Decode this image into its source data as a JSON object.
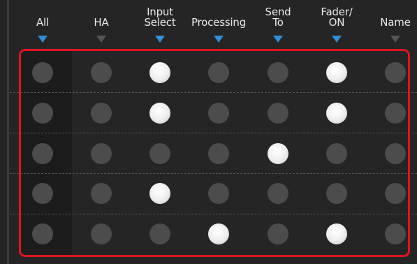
{
  "columns": [
    {
      "key": "all",
      "label": "All",
      "arrow_color": "#2f90d7"
    },
    {
      "key": "ha",
      "label": "HA",
      "arrow_color": "#555555"
    },
    {
      "key": "input_select",
      "label": "Input\nSelect",
      "arrow_color": "#2f90d7"
    },
    {
      "key": "processing",
      "label": "Processing",
      "arrow_color": "#2f90d7"
    },
    {
      "key": "send_to",
      "label": "Send\nTo",
      "arrow_color": "#2f90d7"
    },
    {
      "key": "fader_on",
      "label": "Fader/\nON",
      "arrow_color": "#2f90d7"
    },
    {
      "key": "name",
      "label": "Name",
      "arrow_color": "#555555"
    }
  ],
  "rows": [
    [
      false,
      false,
      true,
      false,
      false,
      true,
      false
    ],
    [
      false,
      false,
      true,
      false,
      false,
      true,
      false
    ],
    [
      false,
      false,
      false,
      false,
      true,
      false,
      false
    ],
    [
      false,
      false,
      true,
      false,
      false,
      false,
      false
    ],
    [
      false,
      false,
      false,
      true,
      false,
      true,
      false
    ]
  ],
  "colors": {
    "highlight_frame": "#e0141e",
    "selected_arrow": "#2f90d7",
    "unselected_arrow": "#555555",
    "dot_off": "#4c4c4c",
    "dot_on": "#f2f2f2"
  }
}
